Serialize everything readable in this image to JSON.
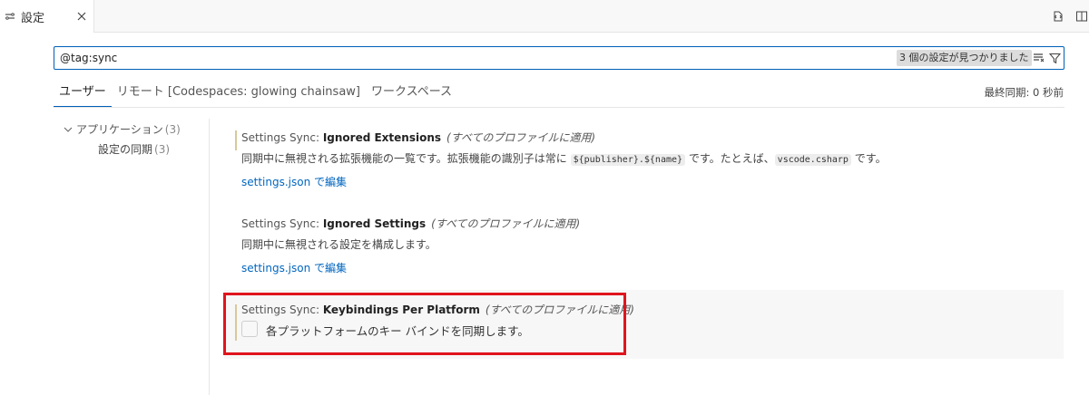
{
  "tab": {
    "label": "設定",
    "icon": "settings-sliders-icon",
    "close_icon": "close-icon"
  },
  "tabbar_actions": [
    "open-settings-json-icon",
    "split-editor-icon"
  ],
  "search": {
    "value": "@tag:sync",
    "result_count": "3 個の設定が見つかりました",
    "clear_icon": "clear-filter-icon",
    "filter_icon": "filter-icon"
  },
  "scope_tabs": [
    {
      "label": "ユーザー",
      "active": true
    },
    {
      "label": "リモート [Codespaces: glowing chainsaw]",
      "active": false
    },
    {
      "label": "ワークスペース",
      "active": false
    }
  ],
  "last_sync": "最終同期: 0 秒前",
  "toc": {
    "group": {
      "label": "アプリケーション",
      "count": "(3)"
    },
    "child": {
      "label": "設定の同期",
      "count": "(3)"
    }
  },
  "settings": [
    {
      "category": "Settings Sync: ",
      "name": "Ignored Extensions",
      "scope": "(すべてのプロファイルに適用)",
      "desc_part1": "同期中に無視される拡張機能の一覧です。拡張機能の識別子は常に ",
      "code1": "${publisher}.${name}",
      "desc_part2": " です。たとえば、",
      "code2": "vscode.csharp",
      "desc_part3": " です。",
      "link": "settings.json で編集"
    },
    {
      "category": "Settings Sync: ",
      "name": "Ignored Settings",
      "scope": "(すべてのプロファイルに適用)",
      "desc": "同期中に無視される設定を構成します。",
      "link": "settings.json で編集"
    },
    {
      "category": "Settings Sync: ",
      "name": "Keybindings Per Platform",
      "scope": "(すべてのプロファイルに適用)",
      "checkbox_label": "各プラットフォームのキー バインドを同期します。",
      "checked": false
    }
  ],
  "colors": {
    "accent": "#005fb8",
    "link": "#0066bf",
    "highlight": "#e0141d"
  }
}
